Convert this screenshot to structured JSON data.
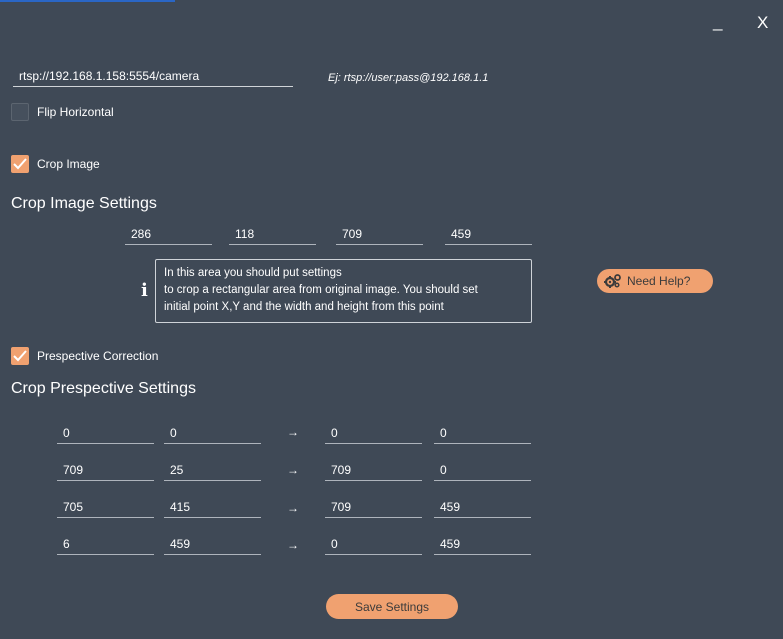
{
  "window": {
    "minimize_label": "_",
    "close_label": "X"
  },
  "stream": {
    "url": "rtsp://192.168.1.158:5554/camera",
    "hint": "Ej: rtsp://user:pass@192.168.1.1"
  },
  "flip_horizontal": {
    "label": "Flip Horizontal",
    "checked": false
  },
  "crop_image": {
    "label": "Crop Image",
    "checked": true
  },
  "crop_settings": {
    "title": "Crop Image Settings",
    "values": [
      "286",
      "118",
      "709",
      "459"
    ],
    "info_lines": [
      "In this area you should put settings",
      "to crop a rectangular area from original image. You should set",
      "initial point X,Y and the width and height from this point"
    ]
  },
  "help_button": {
    "label": "Need Help?",
    "icon": "gears-icon"
  },
  "perspective": {
    "label": "Prespective Correction",
    "checked": true
  },
  "perspective_settings": {
    "title": "Crop Prespective  Settings",
    "arrow": "→",
    "rows": [
      {
        "src": [
          "0",
          "0"
        ],
        "dst": [
          "0",
          "0"
        ]
      },
      {
        "src": [
          "709",
          "25"
        ],
        "dst": [
          "709",
          "0"
        ]
      },
      {
        "src": [
          "705",
          "415"
        ],
        "dst": [
          "709",
          "459"
        ]
      },
      {
        "src": [
          "6",
          "459"
        ],
        "dst": [
          "0",
          "459"
        ]
      }
    ]
  },
  "save_button": {
    "label": "Save Settings"
  },
  "colors": {
    "background": "#3f4956",
    "accent": "#f0a170"
  }
}
